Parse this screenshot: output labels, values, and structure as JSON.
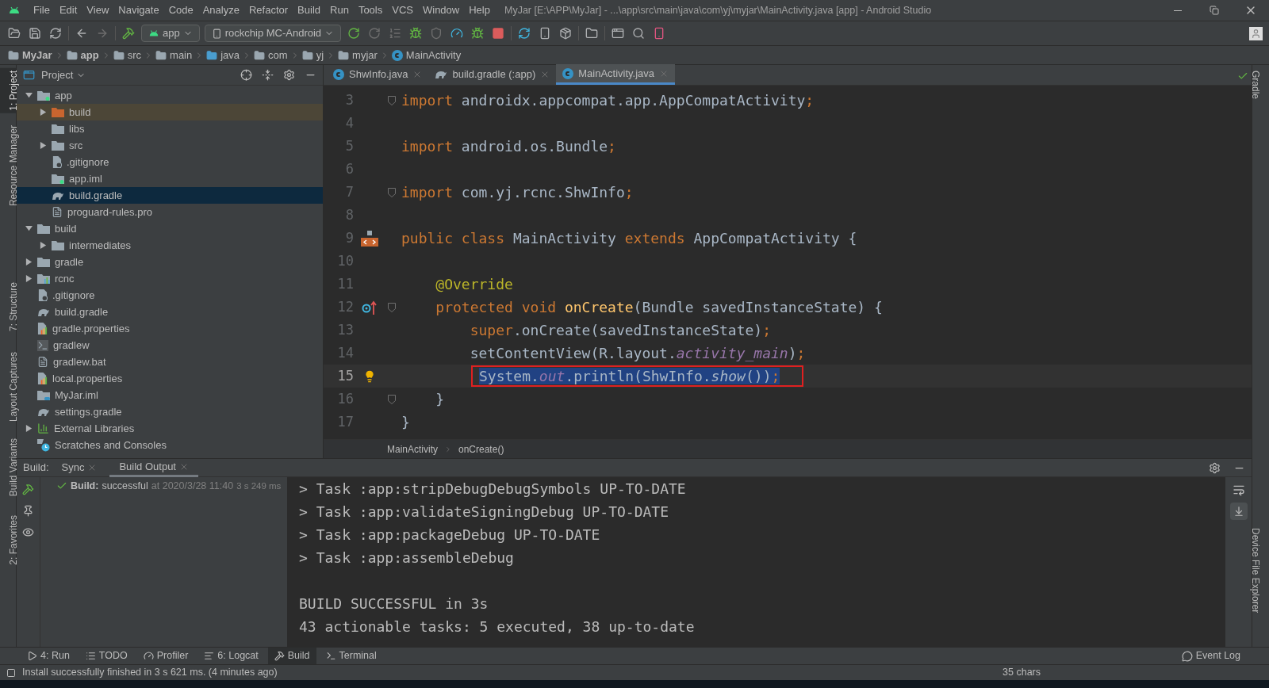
{
  "title_bar": {
    "menu": [
      "File",
      "Edit",
      "View",
      "Navigate",
      "Code",
      "Analyze",
      "Refactor",
      "Build",
      "Run",
      "Tools",
      "VCS",
      "Window",
      "Help"
    ],
    "title": "MyJar [E:\\APP\\MyJar] - ...\\app\\src\\main\\java\\com\\yj\\myjar\\MainActivity.java [app] - Android Studio"
  },
  "toolbar": {
    "config": "app",
    "device": "rockchip MC-Android"
  },
  "nav_bar": [
    {
      "label": "MyJar",
      "kind": "project"
    },
    {
      "label": "app",
      "kind": "module"
    },
    {
      "label": "src",
      "kind": "folder"
    },
    {
      "label": "main",
      "kind": "folder"
    },
    {
      "label": "java",
      "kind": "source"
    },
    {
      "label": "com",
      "kind": "package"
    },
    {
      "label": "yj",
      "kind": "package"
    },
    {
      "label": "myjar",
      "kind": "package"
    },
    {
      "label": "MainActivity",
      "kind": "class"
    }
  ],
  "left_stripe": [
    {
      "label": "1: Project",
      "selected": true
    },
    {
      "label": "Resource Manager",
      "selected": false
    },
    {
      "label": "7: Structure",
      "selected": false
    },
    {
      "label": "Layout Captures",
      "selected": false
    },
    {
      "label": "Build Variants",
      "selected": false
    },
    {
      "label": "2: Favorites",
      "selected": false
    }
  ],
  "right_stripe": [
    "Gradle",
    "Device File Explorer"
  ],
  "project": {
    "title": "Project",
    "tree": [
      {
        "label": "app",
        "kind": "module",
        "expanded": true,
        "selected": false,
        "children": [
          {
            "label": "build",
            "kind": "excluded",
            "expanded": false,
            "selected": false
          },
          {
            "label": "libs",
            "kind": "folder",
            "selected": false
          },
          {
            "label": "src",
            "kind": "folder",
            "expanded": false,
            "selected": false
          },
          {
            "label": ".gitignore",
            "kind": "ignore",
            "selected": false
          },
          {
            "label": "app.iml",
            "kind": "module",
            "selected": false
          },
          {
            "label": "build.gradle",
            "kind": "gradle",
            "selected": true
          },
          {
            "label": "proguard-rules.pro",
            "kind": "text",
            "selected": false
          }
        ]
      },
      {
        "label": "build",
        "kind": "folder",
        "expanded": true,
        "selected": false,
        "children": [
          {
            "label": "intermediates",
            "kind": "folder",
            "expanded": false,
            "selected": false
          }
        ]
      },
      {
        "label": "gradle",
        "kind": "folder",
        "expanded": false,
        "selected": false
      },
      {
        "label": "rcnc",
        "kind": "library",
        "expanded": false,
        "selected": false
      },
      {
        "label": ".gitignore",
        "kind": "ignore",
        "selected": false
      },
      {
        "label": "build.gradle",
        "kind": "gradle",
        "selected": false
      },
      {
        "label": "gradle.properties",
        "kind": "properties",
        "selected": false
      },
      {
        "label": "gradlew",
        "kind": "script",
        "selected": false
      },
      {
        "label": "gradlew.bat",
        "kind": "text",
        "selected": false
      },
      {
        "label": "local.properties",
        "kind": "properties",
        "selected": false
      },
      {
        "label": "MyJar.iml",
        "kind": "iml",
        "selected": false
      },
      {
        "label": "settings.gradle",
        "kind": "gradle",
        "selected": false
      },
      {
        "label": "External Libraries",
        "kind": "libraries",
        "expanded": false,
        "selected": false
      },
      {
        "label": "Scratches and Consoles",
        "kind": "scratches",
        "selected": false
      }
    ]
  },
  "editor": {
    "tabs": [
      {
        "label": "ShwInfo.java",
        "kind": "class",
        "selected": false
      },
      {
        "label": "build.gradle (:app)",
        "kind": "gradle",
        "selected": false
      },
      {
        "label": "MainActivity.java",
        "kind": "class",
        "selected": true
      }
    ],
    "lines": [
      {
        "number": "3",
        "fold": true,
        "selected": false,
        "tokens": [
          {
            "text": "import",
            "kind": "kw"
          },
          {
            "text": " androidx.appcompat.app.AppCompatActivity",
            "kind": "id"
          },
          {
            "text": ";",
            "kind": "kw"
          }
        ]
      },
      {
        "number": "4",
        "fold": false,
        "selected": false
      },
      {
        "number": "5",
        "fold": false,
        "selected": false,
        "tokens": [
          {
            "text": "import",
            "kind": "kw"
          },
          {
            "text": " android.os.Bundle",
            "kind": "id"
          },
          {
            "text": ";",
            "kind": "kw"
          }
        ]
      },
      {
        "number": "6",
        "fold": false,
        "selected": false
      },
      {
        "number": "7",
        "fold": true,
        "selected": false,
        "tokens": [
          {
            "text": "import",
            "kind": "kw"
          },
          {
            "text": " com.yj.rcnc.ShwInfo",
            "kind": "id"
          },
          {
            "text": ";",
            "kind": "kw"
          }
        ]
      },
      {
        "number": "8",
        "fold": false,
        "selected": false
      },
      {
        "number": "9",
        "gutter": {
          "kind": "class"
        },
        "fold": false,
        "selected": false,
        "tokens": [
          {
            "text": "public class",
            "kind": "kw"
          },
          {
            "text": " MainActivity ",
            "kind": "id"
          },
          {
            "text": "extends",
            "kind": "kw"
          },
          {
            "text": " AppCompatActivity {",
            "kind": "id"
          }
        ]
      },
      {
        "number": "10",
        "fold": false,
        "selected": false
      },
      {
        "number": "11",
        "fold": false,
        "selected": false,
        "tokens": [
          {
            "text": "    @Override",
            "kind": "ann"
          }
        ]
      },
      {
        "number": "12",
        "gutter": {
          "kind": "override"
        },
        "fold": true,
        "selected": false,
        "tokens": [
          {
            "text": "    protected void ",
            "kind": "kw"
          },
          {
            "text": "onCreate",
            "kind": "decl"
          },
          {
            "text": "(Bundle savedInstanceState) {",
            "kind": "id"
          }
        ]
      },
      {
        "number": "13",
        "fold": false,
        "selected": false,
        "tokens": [
          {
            "text": "        super",
            "kind": "kw"
          },
          {
            "text": ".onCreate(savedInstanceState)",
            "kind": "id"
          },
          {
            "text": ";",
            "kind": "kw"
          }
        ]
      },
      {
        "number": "14",
        "fold": false,
        "selected": false,
        "tokens": [
          {
            "text": "        setContentView(R.layout.",
            "kind": "id"
          },
          {
            "text": "activity_main",
            "kind": "field"
          },
          {
            "text": ")",
            "kind": "id"
          },
          {
            "text": ";",
            "kind": "kw"
          }
        ]
      },
      {
        "number": "15",
        "gutter": {
          "kind": "bulb"
        },
        "fold": false,
        "selected": true,
        "tokens": [
          {
            "text": "System.",
            "kind": "id"
          },
          {
            "text": "out",
            "kind": "field"
          },
          {
            "text": ".println(ShwInfo.",
            "kind": "id"
          },
          {
            "text": "show",
            "kind": "static"
          },
          {
            "text": "())",
            "kind": "id"
          },
          {
            "text": ";",
            "kind": "kw"
          }
        ]
      },
      {
        "number": "16",
        "fold": true,
        "selected": false,
        "tokens": [
          {
            "text": "    }",
            "kind": "id"
          }
        ]
      },
      {
        "number": "17",
        "fold": false,
        "selected": false,
        "tokens": [
          {
            "text": "}",
            "kind": "id"
          }
        ]
      }
    ],
    "breadcrumbs": [
      "MainActivity",
      "onCreate()"
    ]
  },
  "build": {
    "label": "Build:",
    "tabs": [
      {
        "label": "Sync",
        "selected": false
      },
      {
        "label": "Build Output",
        "selected": true
      }
    ],
    "result": {
      "title": "Build:",
      "status": "successful",
      "time": "at 2020/3/28 11:40",
      "duration": "3 s 249 ms"
    },
    "output": [
      [
        "> Task :app:stripDebugDebugSymbols UP-TO-DATE",
        "> Task :app:validateSigningDebug UP-TO-DATE",
        "> Task :app:packageDebug UP-TO-DATE",
        "> Task :app:assembleDebug"
      ],
      [
        "BUILD SUCCESSFUL in 3s",
        "43 actionable tasks: 5 executed, 38 up-to-date"
      ]
    ]
  },
  "bottom_tabs": [
    {
      "label": "4: Run",
      "kind": "run",
      "selected": false
    },
    {
      "label": "TODO",
      "kind": "todo",
      "selected": false
    },
    {
      "label": "Profiler",
      "kind": "profiler",
      "selected": false
    },
    {
      "label": "6: Logcat",
      "kind": "logcat",
      "selected": false
    },
    {
      "label": "Build",
      "kind": "build",
      "selected": true
    },
    {
      "label": "Terminal",
      "kind": "terminal",
      "selected": false
    }
  ],
  "event_log": "Event Log",
  "status_bar": {
    "message": "Install successfully finished in 3 s 621 ms. (4 minutes ago)",
    "items": [
      "35 chars"
    ]
  }
}
